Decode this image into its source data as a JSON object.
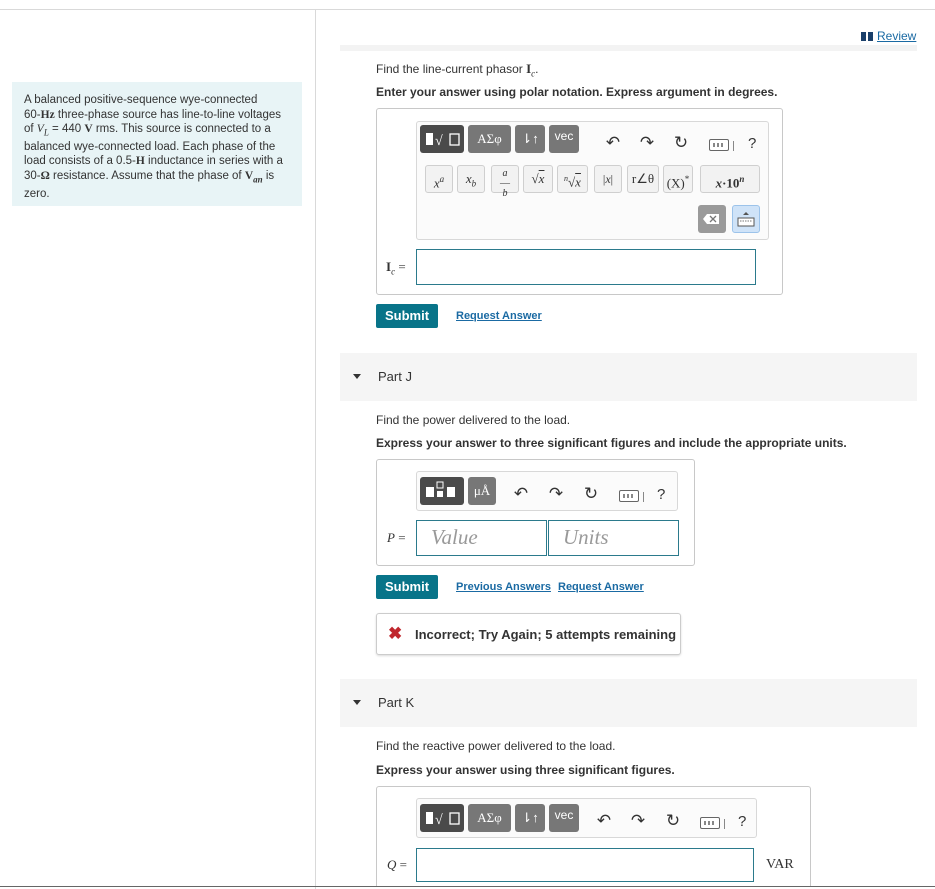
{
  "header": {
    "review_label": "Review"
  },
  "problem": {
    "l1": "A balanced positive-sequence wye-connected",
    "l2a": "60-",
    "l2u": "Hz",
    "l2b": " three-phase source has line-to-line voltages",
    "l3a": "of ",
    "l3v": "V",
    "l3s": "L",
    "l3b": " = 440 ",
    "l3u": "V",
    "l3c": " rms. This source is connected to a",
    "l4": "balanced wye-connected load. Each phase of the",
    "l5a": "load consists of a 0.5-",
    "l5u": "H",
    "l5b": " inductance in series with a",
    "l6a": "30-",
    "l6u": "Ω",
    "l6b": " resistance. Assume that the phase of ",
    "l6v": "V",
    "l6s": "an",
    "l6c": " is",
    "l7": "zero."
  },
  "part_i": {
    "prompt_a": "Find the line-current phasor ",
    "prompt_sym": "I",
    "prompt_sub": "c",
    "prompt_end": ".",
    "instruction": "Enter your answer using polar notation. Express argument in degrees.",
    "toolbar": {
      "b1": "",
      "b2": "ΑΣφ",
      "b3": "⇂↑",
      "b4": "vec",
      "help": "?"
    },
    "math": [
      "xª",
      "x_b",
      "a/b",
      "√x",
      "ⁿ√x",
      "|x|",
      "r∠θ",
      "(X)*",
      "x·10ⁿ"
    ],
    "label_sym": "I",
    "label_sub": "c",
    "label_eq": " =",
    "submit": "Submit",
    "request": "Request Answer"
  },
  "part_j": {
    "title": "Part J",
    "prompt": "Find the power delivered to the load.",
    "instruction": "Express your answer to three significant figures and include the appropriate units.",
    "toolbar": {
      "b2": "μÅ",
      "help": "?"
    },
    "label": "P",
    "label_eq": " =",
    "value_placeholder": "Value",
    "units_placeholder": "Units",
    "submit": "Submit",
    "previous": "Previous Answers",
    "request": "Request Answer",
    "feedback": "Incorrect; Try Again; 5 attempts remaining"
  },
  "part_k": {
    "title": "Part K",
    "prompt": "Find the reactive power delivered to the load.",
    "instruction": "Express your answer using three significant figures.",
    "toolbar": {
      "b2": "ΑΣφ",
      "b3": "⇂↑",
      "b4": "vec",
      "help": "?"
    },
    "label": "Q",
    "label_eq": " =",
    "unit": "VAR"
  }
}
